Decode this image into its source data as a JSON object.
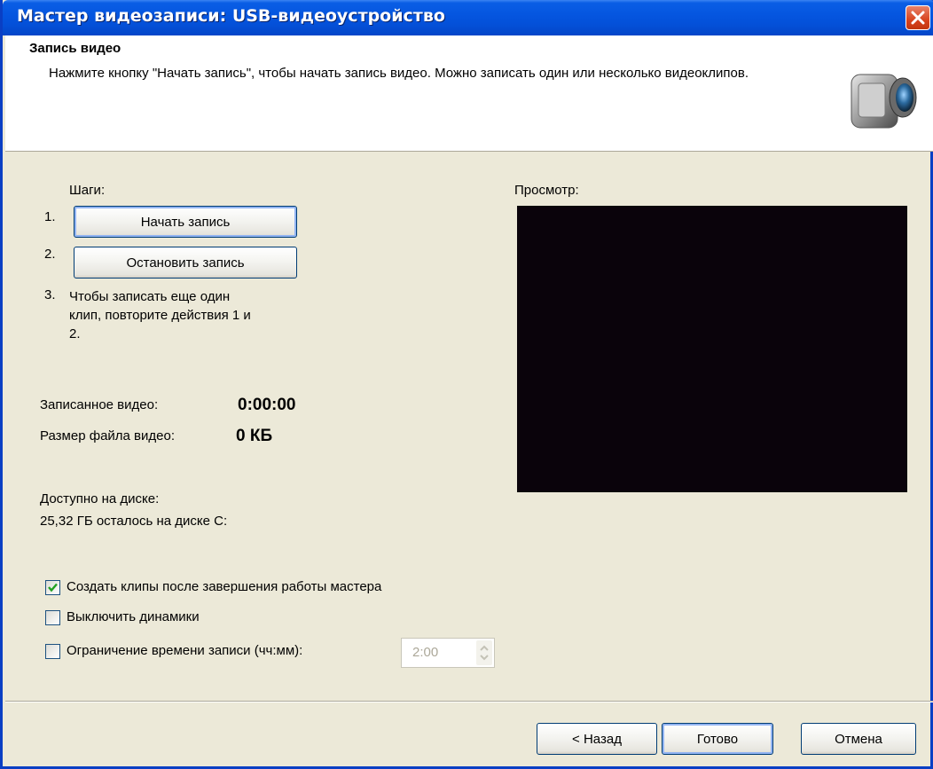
{
  "window": {
    "title": "Мастер видеозаписи: USB-видеоустройство"
  },
  "header": {
    "title": "Запись видео",
    "description": "Нажмите кнопку \"Начать запись\", чтобы начать запись видео. Можно записать один или несколько видеоклипов."
  },
  "steps": {
    "heading": "Шаги:",
    "step1_num": "1.",
    "step1_button": "Начать запись",
    "step2_num": "2.",
    "step2_button": "Остановить запись",
    "step3_num": "3.",
    "step3_text": "Чтобы записать еще один клип, повторите действия 1 и 2."
  },
  "recorded": {
    "label": "Записанное видео:",
    "value": "0:00:00"
  },
  "filesize": {
    "label": "Размер файла видео:",
    "value": "0 КБ"
  },
  "disk": {
    "label": "Доступно на диске:",
    "value": "25,32 ГБ осталось на диске C:"
  },
  "preview": {
    "label": "Просмотр:"
  },
  "options": {
    "create_clips": {
      "label": "Создать клипы после завершения работы мастера",
      "checked": true
    },
    "mute_speakers": {
      "label": "Выключить динамики",
      "checked": false
    },
    "time_limit": {
      "label": "Ограничение времени записи (чч:мм):",
      "checked": false,
      "value": "2:00"
    }
  },
  "footer": {
    "back": "< Назад",
    "finish": "Готово",
    "cancel": "Отмена"
  }
}
